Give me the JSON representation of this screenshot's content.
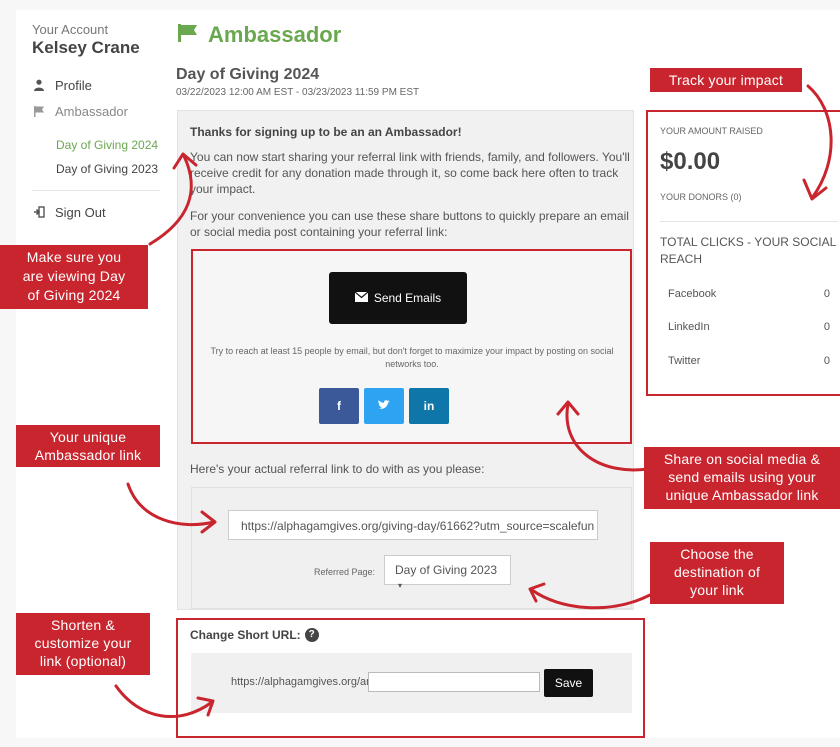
{
  "sidebar": {
    "account_label": "Your Account",
    "account_name": "Kelsey Crane",
    "profile_label": "Profile",
    "ambassador_label": "Ambassador",
    "sub_items": [
      "Day of Giving 2024",
      "Day of Giving 2023"
    ],
    "sign_out_label": "Sign Out"
  },
  "main": {
    "page_title": "Ambassador",
    "event_title": "Day of Giving 2024",
    "event_dates": "03/22/2023 12:00 AM EST - 03/23/2023 11:59 PM EST",
    "intro_title": "Thanks for signing up to be an an Ambassador!",
    "intro_text": "You can now start sharing your referral link with friends, family, and followers. You'll receive credit for any donation made through it, so come back here often to track your impact.",
    "share_text": "For your convenience you can use these share buttons to quickly prepare an email or social media post containing your referral link:",
    "send_emails_label": "Send Emails",
    "share_note": "Try to reach at least 15 people by email, but don't forget to maximize your impact by posting on social networks too.",
    "social_buttons": [
      "f",
      "in"
    ],
    "referral_label": "Here's your actual referral link to do with as you please:",
    "referral_url": "https://alphagamgives.org/giving-day/61662?utm_source=scalefun",
    "referred_page_label": "Referred Page:",
    "referred_page_value": "Day of Giving 2023",
    "short_url_title": "Change Short URL:",
    "short_url_prefix": "https://alphagamgives.org/amb/",
    "short_url_value": "",
    "save_label": "Save"
  },
  "stats": {
    "amount_label": "YOUR AMOUNT RAISED",
    "amount_value": "$0.00",
    "donors_label": "YOUR DONORS (0)",
    "clicks_title": "TOTAL CLICKS - YOUR SOCIAL REACH",
    "clicks": [
      {
        "network": "Facebook",
        "count": "0"
      },
      {
        "network": "LinkedIn",
        "count": "0"
      },
      {
        "network": "Twitter",
        "count": "0"
      }
    ]
  },
  "callouts": {
    "track_impact": "Track your impact",
    "viewing": [
      "Make sure you",
      "are viewing Day",
      "of Giving 2024"
    ],
    "unique_link": [
      "Your unique",
      "Ambassador link"
    ],
    "share_social": [
      "Share on social media &",
      "send emails using your",
      "unique Ambassador link"
    ],
    "destination": [
      "Choose the",
      "destination of",
      "your link"
    ],
    "shorten": [
      "Shorten &",
      "customize your",
      "link (optional)"
    ]
  },
  "colors": {
    "accent_green": "#6aa84f",
    "callout_red": "#c9252e",
    "facebook": "#3b5998",
    "twitter": "#2ea3f2",
    "linkedin": "#0e76a8"
  }
}
